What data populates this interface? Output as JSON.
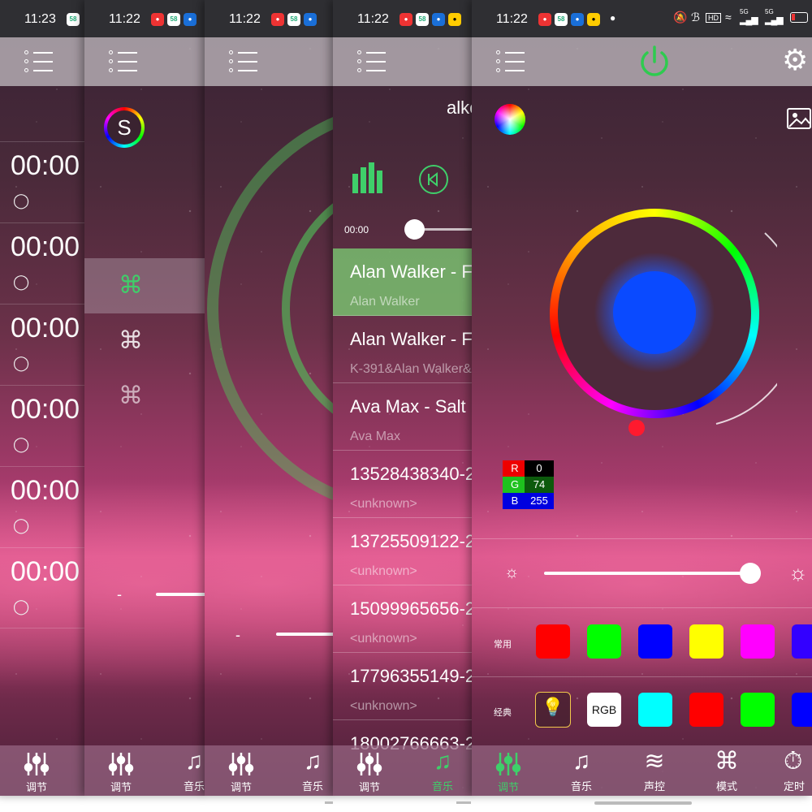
{
  "colors": {
    "active_green": "#3fcf6a",
    "selected_song_bg": "#7cbe6e",
    "preview_blue": "#0a4aff",
    "swatch_red": "#ff0000",
    "swatch_green": "#00ff00",
    "swatch_blue": "#0000ff",
    "swatch_yellow": "#ffff00",
    "swatch_magenta": "#ff00ff",
    "swatch_cyan": "#00ffff"
  },
  "status": {
    "panel1_time": "11:23",
    "panel2_time": "11:22",
    "panel3_time": "11:22",
    "panel4_time": "11:22",
    "panel5_time": "11:22",
    "signal_labels": [
      "HD",
      "5G",
      "5G"
    ]
  },
  "timer_panel": {
    "rows": [
      {
        "time": "00:00"
      },
      {
        "time": "00:00"
      },
      {
        "time": "00:00"
      },
      {
        "time": "00:00"
      },
      {
        "time": "00:00"
      },
      {
        "time": "00:00"
      }
    ],
    "tab_label": "调节"
  },
  "mode_panel": {
    "logo_letter": "S",
    "items": [
      "mode-selected",
      "mode-2",
      "mode-3"
    ],
    "slider_minus": "-",
    "tabs": [
      "调节",
      "音乐"
    ]
  },
  "mic_panel": {
    "slider_minus": "-",
    "tabs": [
      "调节",
      "音乐"
    ]
  },
  "music_panel": {
    "artist_header": "alke",
    "time_elapsed": "00:00",
    "songs": [
      {
        "title": "Alan Walker - F",
        "artist": "Alan Walker"
      },
      {
        "title": "Alan Walker - F",
        "artist": "K-391&Alan Walker&"
      },
      {
        "title": "Ava Max - Salt",
        "artist": "Ava Max"
      },
      {
        "title": "13528438340-2",
        "artist": "<unknown>"
      },
      {
        "title": "13725509122-2",
        "artist": "<unknown>"
      },
      {
        "title": "15099965656-2",
        "artist": "<unknown>"
      },
      {
        "title": "17796355149-2",
        "artist": "<unknown>"
      },
      {
        "title": "18002766663-2",
        "artist": ""
      }
    ],
    "playback_position": 0,
    "tabs": [
      "调节",
      "音乐"
    ]
  },
  "color_panel": {
    "rgb": {
      "r_label": "R",
      "r_value": "0",
      "g_label": "G",
      "g_value": "74",
      "b_label": "B",
      "b_value": "255"
    },
    "brightness": 0.95,
    "common_label": "常用",
    "classic_label": "经典",
    "rgb_button_label": "RGB",
    "tabs": [
      "调节",
      "音乐",
      "声控",
      "模式",
      "定时"
    ]
  }
}
